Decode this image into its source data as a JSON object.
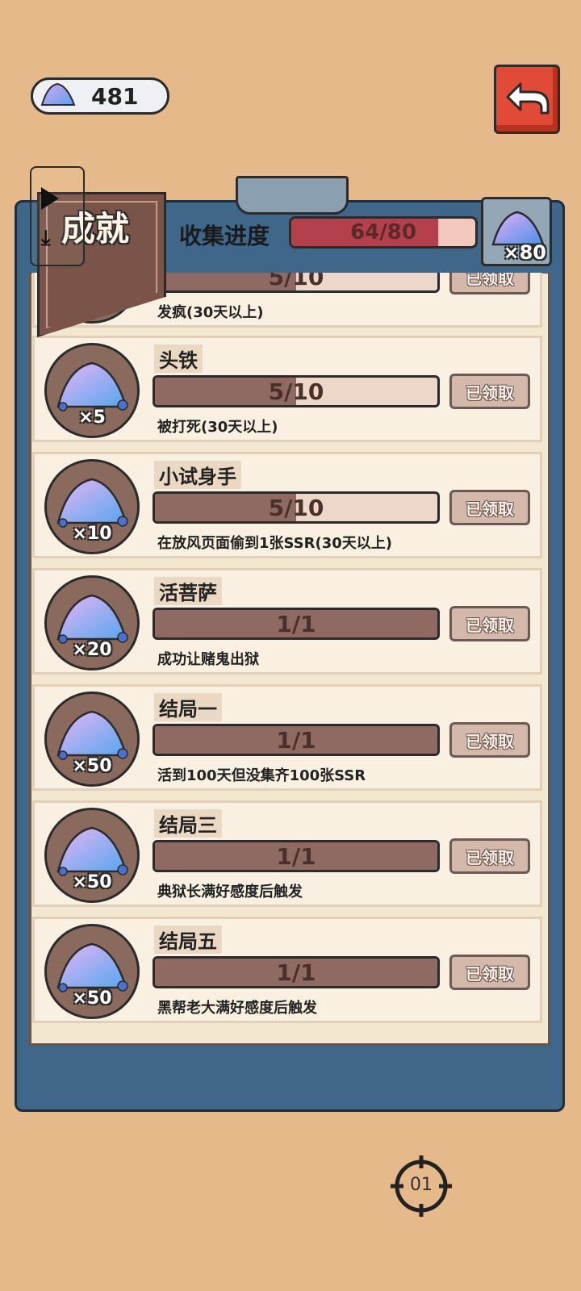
{
  "currency": {
    "icon": "crystal-icon",
    "value": "481"
  },
  "back_button": {
    "icon": "return-arrow-icon"
  },
  "header": {
    "title": "成就",
    "collect_label": "收集进度",
    "progress_text": "64/80",
    "progress_fraction": 0.8,
    "reward_qty": "×80"
  },
  "overlay": {
    "play_icon": "play-icon",
    "download_icon": "download-icon"
  },
  "achievements": [
    {
      "name": "",
      "progress_text": "5/10",
      "fraction": 0.5,
      "desc": "发疯(30天以上)",
      "reward_qty": "",
      "claim": "已领取"
    },
    {
      "name": "头铁",
      "progress_text": "5/10",
      "fraction": 0.5,
      "desc": "被打死(30天以上)",
      "reward_qty": "×5",
      "claim": "已领取"
    },
    {
      "name": "小试身手",
      "progress_text": "5/10",
      "fraction": 0.5,
      "desc": "在放风页面偷到1张SSR(30天以上)",
      "reward_qty": "×10",
      "claim": "已领取"
    },
    {
      "name": "活菩萨",
      "progress_text": "1/1",
      "fraction": 1.0,
      "desc": "成功让赌鬼出狱",
      "reward_qty": "×20",
      "claim": "已领取"
    },
    {
      "name": "结局一",
      "progress_text": "1/1",
      "fraction": 1.0,
      "desc": "活到100天但没集齐100张SSR",
      "reward_qty": "×50",
      "claim": "已领取"
    },
    {
      "name": "结局三",
      "progress_text": "1/1",
      "fraction": 1.0,
      "desc": "典狱长满好感度后触发",
      "reward_qty": "×50",
      "claim": "已领取"
    },
    {
      "name": "结局五",
      "progress_text": "1/1",
      "fraction": 1.0,
      "desc": "黑帮老大满好感度后触发",
      "reward_qty": "×50",
      "claim": "已领取"
    }
  ],
  "crosshair": {
    "label": "01"
  },
  "colors": {
    "background": "#e6b98a",
    "board": "#3e6789",
    "accent_red": "#e04a36",
    "progress": "#b3404a"
  }
}
